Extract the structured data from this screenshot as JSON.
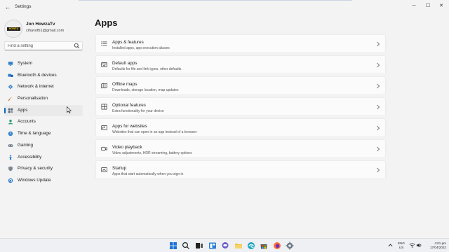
{
  "window": {
    "title": "Settings",
    "back_icon": "back-arrow-icon",
    "controls": [
      "minimize-icon",
      "maximize-icon",
      "close-icon"
    ]
  },
  "user": {
    "name": "Jon HowzaTv",
    "email": "clhavofb1@gmail.com",
    "avatar_logo_text": "HOWZA"
  },
  "search": {
    "placeholder": "Find a setting"
  },
  "sidebar": {
    "items": [
      {
        "label": "System",
        "icon": "monitor-icon"
      },
      {
        "label": "Bluetooth & devices",
        "icon": "bluetooth-icon"
      },
      {
        "label": "Network & internet",
        "icon": "network-icon"
      },
      {
        "label": "Personalisation",
        "icon": "brush-icon"
      },
      {
        "label": "Apps",
        "icon": "apps-icon",
        "active": true
      },
      {
        "label": "Accounts",
        "icon": "person-icon"
      },
      {
        "label": "Time & language",
        "icon": "globe-clock-icon"
      },
      {
        "label": "Gaming",
        "icon": "gamepad-icon"
      },
      {
        "label": "Accessibility",
        "icon": "accessibility-icon"
      },
      {
        "label": "Privacy & security",
        "icon": "shield-icon"
      },
      {
        "label": "Windows Update",
        "icon": "update-icon"
      }
    ]
  },
  "main": {
    "title": "Apps",
    "cards": [
      {
        "title": "Apps & features",
        "description": "Installed apps, app execution aliases",
        "icon": "list-icon"
      },
      {
        "title": "Default apps",
        "description": "Defaults for file and link types, other defaults",
        "icon": "default-apps-icon"
      },
      {
        "title": "Offline maps",
        "description": "Downloads, storage location, map updates",
        "icon": "map-icon"
      },
      {
        "title": "Optional features",
        "description": "Extra functionality for your device",
        "icon": "grid-icon"
      },
      {
        "title": "Apps for websites",
        "description": "Websites that can open in an app instead of a browser",
        "icon": "web-app-icon"
      },
      {
        "title": "Video playback",
        "description": "Video adjustments, HDR streaming, battery options",
        "icon": "video-icon"
      },
      {
        "title": "Startup",
        "description": "Apps that start automatically when you sign in",
        "icon": "startup-icon"
      }
    ]
  },
  "taskbar": {
    "apps": [
      "windows-start-icon",
      "search-icon",
      "task-view-icon",
      "widgets-icon",
      "chat-icon",
      "file-explorer-icon",
      "edge-icon",
      "store-icon",
      "firefox-icon",
      "settings-icon"
    ],
    "tray": {
      "language_top": "ENG",
      "language_bottom": "US",
      "time": "4:01 pm",
      "date": "17/04/2022"
    }
  },
  "colors": {
    "accent": "#0067c0",
    "background": "#f3f3f3",
    "card": "#fbfbfb"
  }
}
